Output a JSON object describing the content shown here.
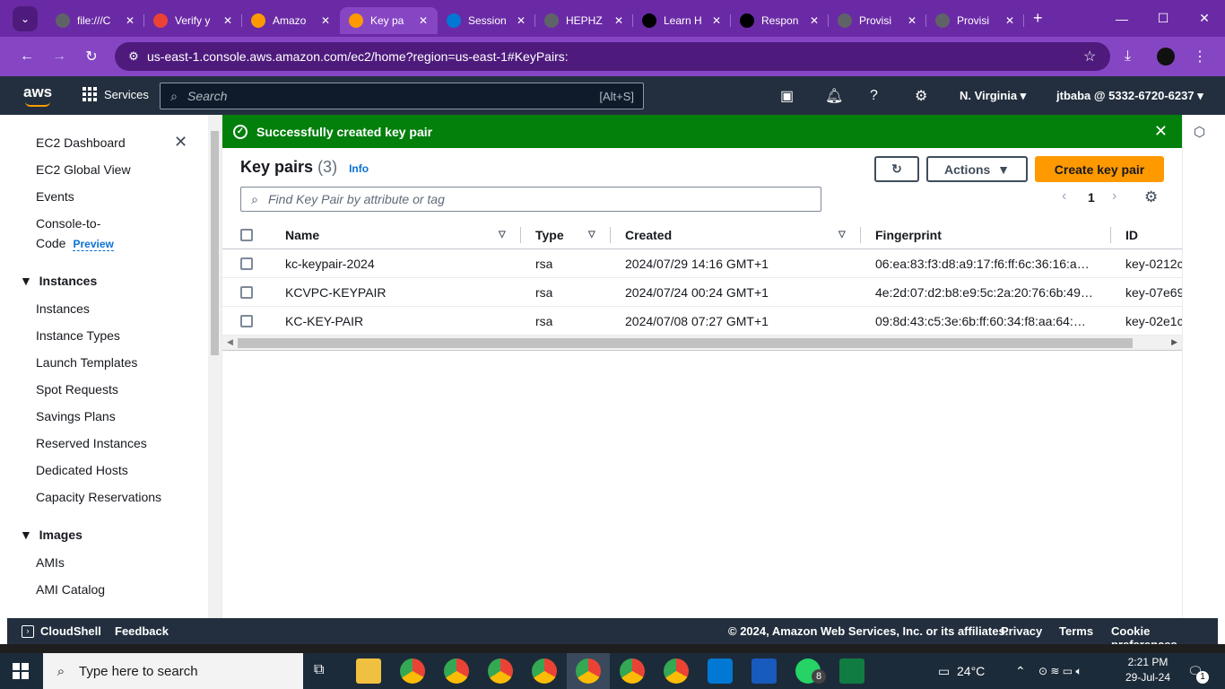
{
  "browser": {
    "tabs": [
      {
        "title": "file:///C",
        "color": "#5f6368"
      },
      {
        "title": "Verify y",
        "color": "#ea4335"
      },
      {
        "title": "Amazo",
        "color": "#ff9900"
      },
      {
        "title": "Key pa",
        "color": "#ff9900"
      },
      {
        "title": "Session",
        "color": "#0078d4"
      },
      {
        "title": "HEPHZ",
        "color": "#5f6368"
      },
      {
        "title": "Learn H",
        "color": "#000000"
      },
      {
        "title": "Respon",
        "color": "#000000"
      },
      {
        "title": "Provisi",
        "color": "#5f6368"
      },
      {
        "title": "Provisi",
        "color": "#5f6368"
      }
    ],
    "active_tab_index": 3,
    "url": "us-east-1.console.aws.amazon.com/ec2/home?region=us-east-1#KeyPairs:"
  },
  "aws_header": {
    "logo": "aws",
    "services_label": "Services",
    "search_placeholder": "Search",
    "search_shortcut": "[Alt+S]",
    "region": "N. Virginia",
    "account": "jtbaba @ 5332-6720-6237"
  },
  "sidebar": {
    "top_items": [
      "EC2 Dashboard",
      "EC2 Global View",
      "Events"
    ],
    "console_to_code": "Console-to-",
    "console_to_code_2": "Code",
    "preview_badge": "Preview",
    "instances_section": "Instances",
    "instances_items": [
      "Instances",
      "Instance Types",
      "Launch Templates",
      "Spot Requests",
      "Savings Plans",
      "Reserved Instances",
      "Dedicated Hosts",
      "Capacity Reservations"
    ],
    "images_section": "Images",
    "images_items": [
      "AMIs",
      "AMI Catalog"
    ]
  },
  "flash": {
    "message": "Successfully created key pair"
  },
  "key_pairs": {
    "title": "Key pairs",
    "count": "(3)",
    "info": "Info",
    "actions_label": "Actions",
    "create_label": "Create key pair",
    "filter_placeholder": "Find Key Pair by attribute or tag",
    "page": "1",
    "columns": [
      "Name",
      "Type",
      "Created",
      "Fingerprint",
      "ID"
    ],
    "rows": [
      {
        "name": "kc-keypair-2024",
        "type": "rsa",
        "created": "2024/07/29 14:16 GMT+1",
        "fingerprint": "06:ea:83:f3:d8:a9:17:f6:ff:6c:36:16:a…",
        "id": "key-0212c"
      },
      {
        "name": "KCVPC-KEYPAIR",
        "type": "rsa",
        "created": "2024/07/24 00:24 GMT+1",
        "fingerprint": "4e:2d:07:d2:b8:e9:5c:2a:20:76:6b:49…",
        "id": "key-07e69"
      },
      {
        "name": "KC-KEY-PAIR",
        "type": "rsa",
        "created": "2024/07/08 07:27 GMT+1",
        "fingerprint": "09:8d:43:c5:3e:6b:ff:60:34:f8:aa:64:…",
        "id": "key-02e1c"
      }
    ]
  },
  "footer": {
    "cloudshell": "CloudShell",
    "feedback": "Feedback",
    "copyright": "© 2024, Amazon Web Services, Inc. or its affiliates.",
    "privacy": "Privacy",
    "terms": "Terms",
    "cookie": "Cookie preferences"
  },
  "taskbar": {
    "search_placeholder": "Type here to search",
    "temperature": "24°C",
    "time": "2:21 PM",
    "date": "29-Jul-24",
    "whatsapp_badge": "8",
    "notification_count": "1"
  }
}
